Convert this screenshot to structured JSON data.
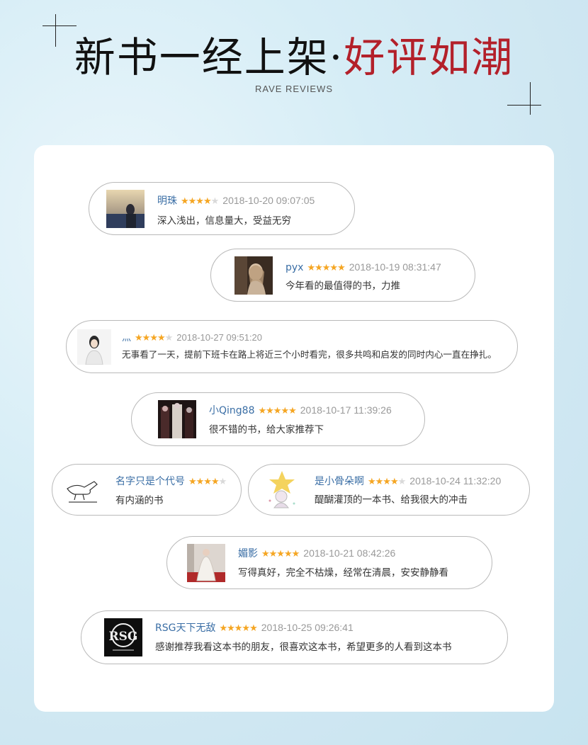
{
  "header": {
    "title_black": "新书一经上架·",
    "title_red": "好评如潮",
    "subtitle": "RAVE REVIEWS",
    "accent_color": "#b3202a"
  },
  "reviews": [
    {
      "name": "明珠",
      "stars": 4,
      "date": "2018-10-20 09:07:05",
      "text": "深入浅出，信息量大，受益无穷",
      "avatar": "landscape-photo"
    },
    {
      "name": "pyx",
      "stars": 5,
      "date": "2018-10-19 08:31:47",
      "text": "今年看的最值得的书，力推",
      "avatar": "portrait-photo"
    },
    {
      "name": "灬",
      "stars": 4,
      "date": "2018-10-27 09:51:20",
      "text": "无事看了一天，提前下班卡在路上将近三个小时看完，很多共鸣和启发的同时内心一直在挣扎。",
      "avatar": "portrait-photo"
    },
    {
      "name": "小Qing88",
      "stars": 5,
      "date": "2018-10-17 11:39:26",
      "text": "很不错的书，给大家推荐下",
      "avatar": "group-photo"
    },
    {
      "name": "名字只是个代号",
      "stars": 4,
      "date": "",
      "text": "有内涵的书",
      "avatar": "dinosaur-sketch"
    },
    {
      "name": "是小骨朵啊",
      "stars": 4,
      "date": "2018-10-24 11:32:20",
      "text": "醍醐灌顶的一本书、给我很大的冲击",
      "avatar": "star-doll"
    },
    {
      "name": "媚影",
      "stars": 5,
      "date": "2018-10-21 08:42:26",
      "text": "写得真好，完全不枯燥，经常在清晨，安安静静看",
      "avatar": "dress-photo"
    },
    {
      "name": "RSG天下无敌",
      "stars": 5,
      "date": "2018-10-25 09:26:41",
      "text": "感谢推荐我看这本书的朋友，很喜欢这本书，希望更多的人看到这本书",
      "avatar": "rsg-logo"
    }
  ]
}
